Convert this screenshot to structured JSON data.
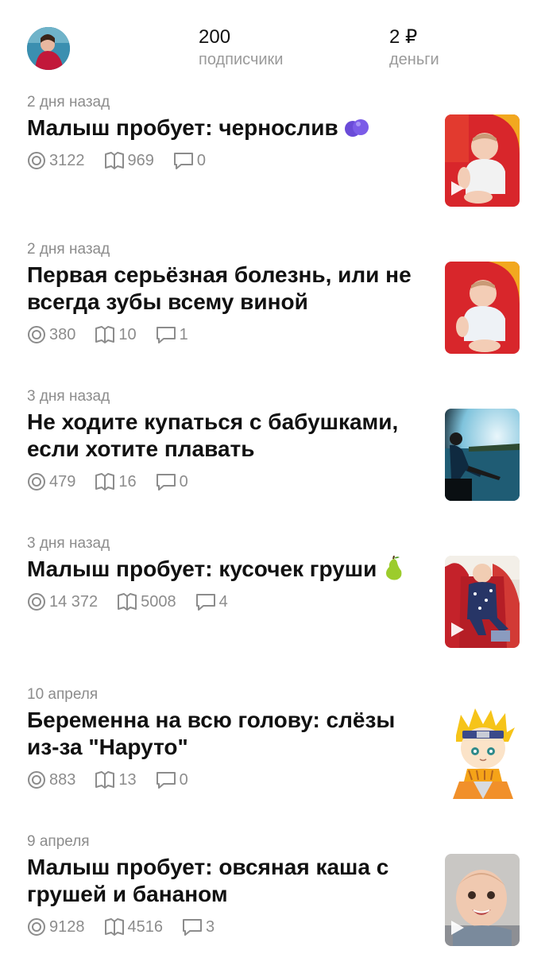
{
  "profile": {
    "subscribers_count": "200",
    "subscribers_label": "подписчики",
    "money_value": "2 ₽",
    "money_label": "деньги"
  },
  "posts": [
    {
      "date": "2 дня назад",
      "title": "Малыш пробует: чернослив",
      "emoji": "plum-emoji",
      "views": "3122",
      "reads": "969",
      "comments": "0",
      "thumbnail": "baby-in-red-chair",
      "has_video": true
    },
    {
      "date": "2 дня назад",
      "title": "Первая серьёзная болезнь, или не всегда зубы всему виной",
      "views": "380",
      "reads": "10",
      "comments": "1",
      "thumbnail": "baby-in-red-chair",
      "has_video": false
    },
    {
      "date": "3 дня назад",
      "title": "Не ходите купаться с бабушками, если хотите плавать",
      "views": "479",
      "reads": "16",
      "comments": "0",
      "thumbnail": "woman-at-river",
      "has_video": false
    },
    {
      "date": "3 дня назад",
      "title": "Малыш пробует: кусочек груши",
      "emoji": "pear-emoji",
      "views": "14 372",
      "reads": "5008",
      "comments": "4",
      "thumbnail": "baby-in-chair",
      "has_video": true
    },
    {
      "date": "10 апреля",
      "title": "Беременна на всю голову: слёзы из-за \"Наруто\"",
      "views": "883",
      "reads": "13",
      "comments": "0",
      "thumbnail": "naruto-cartoon",
      "has_video": false
    },
    {
      "date": "9 апреля",
      "title": "Малыш пробует: овсяная каша с грушей и бананом",
      "views": "9128",
      "reads": "4516",
      "comments": "3",
      "thumbnail": "smiling-baby",
      "has_video": true
    }
  ]
}
